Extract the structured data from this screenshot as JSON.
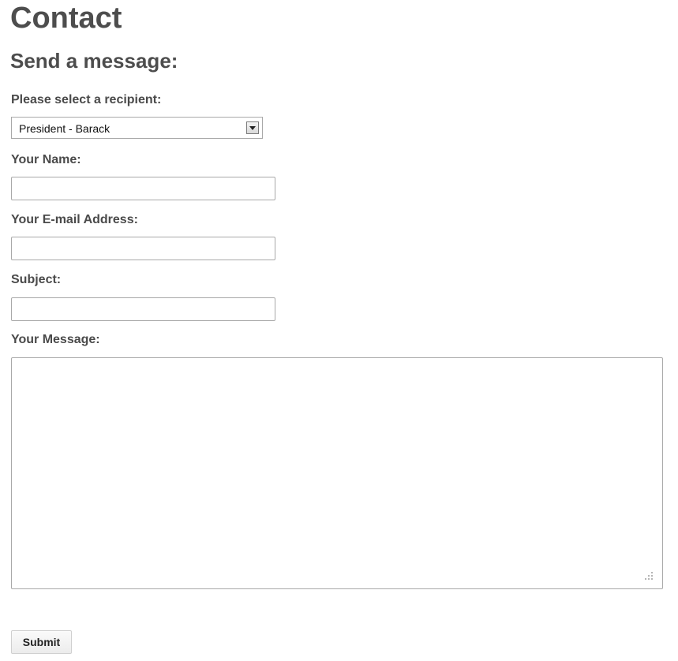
{
  "page": {
    "title": "Contact",
    "section_title": "Send a message:"
  },
  "form": {
    "recipient": {
      "label": "Please select a recipient:",
      "selected": "President - Barack"
    },
    "name": {
      "label": "Your Name:",
      "value": "",
      "placeholder": ""
    },
    "email": {
      "label": "Your E-mail Address:",
      "value": "",
      "placeholder": ""
    },
    "subject": {
      "label": "Subject:",
      "value": "",
      "placeholder": ""
    },
    "message": {
      "label": "Your Message:",
      "value": "",
      "placeholder": ""
    },
    "submit_label": "Submit"
  },
  "icons": {
    "select_arrow": "chevron-down-icon",
    "resize_grip": "resize-grip-icon"
  },
  "colors": {
    "heading": "#4d4d4d",
    "label": "#4a4a4a",
    "border": "#a9a9a9"
  }
}
